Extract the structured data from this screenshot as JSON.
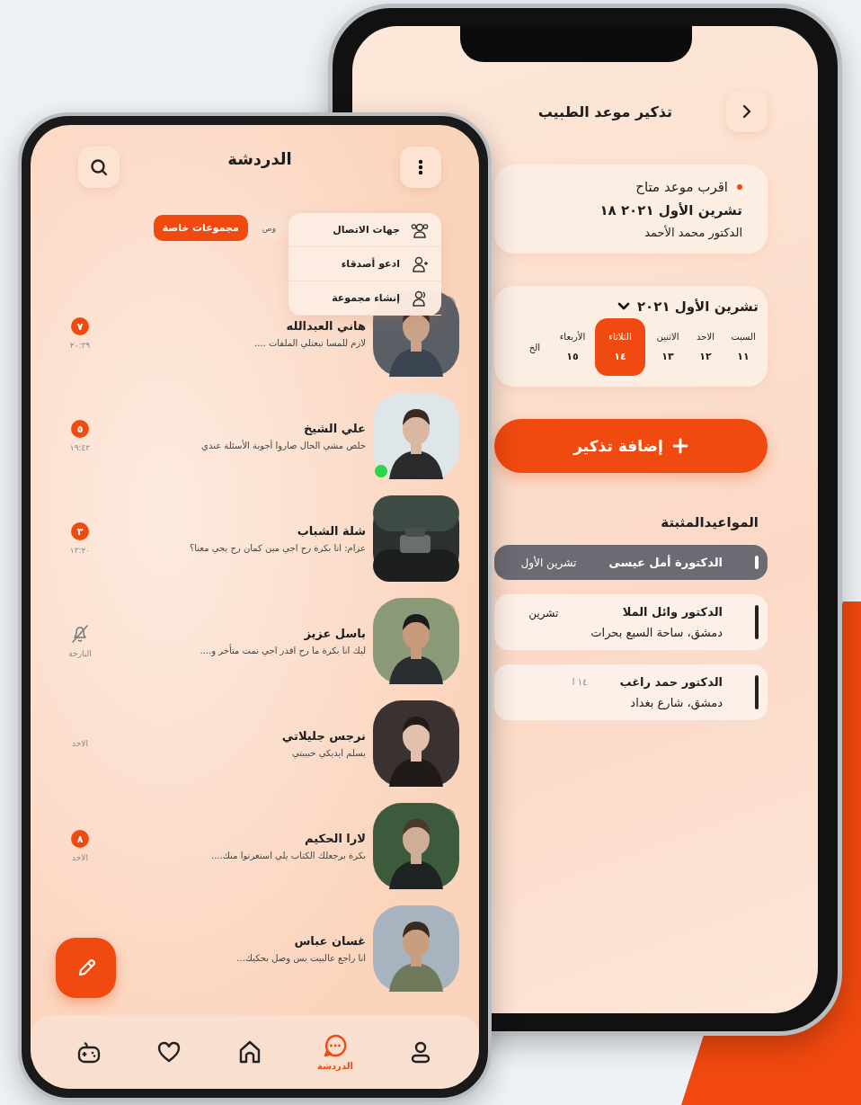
{
  "doctor_app": {
    "title": "تذكير موعد الطبيب",
    "nearest": {
      "label": "اقرب موعد متاح",
      "date": "تشرين الأول ٢٠٢١ ١٨",
      "doctor": "الدكتور محمد الأحمد"
    },
    "calendar": {
      "month": "تشرين الأول ٢٠٢١",
      "days": [
        {
          "name": "السبت",
          "date": "١١",
          "selected": false
        },
        {
          "name": "الاحد",
          "date": "١٢",
          "selected": false
        },
        {
          "name": "الاثنين",
          "date": "١٣",
          "selected": false
        },
        {
          "name": "الثلاثاء",
          "date": "١٤",
          "selected": true
        },
        {
          "name": "الأربعاء",
          "date": "١٥",
          "selected": false
        },
        {
          "name": "الخ",
          "selected": false
        }
      ]
    },
    "add_button": "إضافة تذكير",
    "pinned_title": "المواعيدالمثبتة",
    "pinned": [
      {
        "doctor": "الدكتورة أمل عيسى",
        "date": "تشرين الأول",
        "selected": true
      },
      {
        "doctor": "الدكتور وائل الملا",
        "address": "دمشق، ساحة السبع بحرات",
        "date": "تشرين",
        "selected": false
      },
      {
        "doctor": "الدكتور حمد راغب",
        "address": "دمشق، شارع بغداد",
        "date": "١٤ ا",
        "selected": false
      }
    ]
  },
  "chat_app": {
    "title": "الدردشة",
    "tabs": [
      {
        "label": "وص",
        "selected": false
      },
      {
        "label": "مجموعات خاصة",
        "selected": true
      }
    ],
    "menu": [
      {
        "kind": "contacts",
        "label": "جهات الاتصال"
      },
      {
        "kind": "invite",
        "label": "ادعو أصدقاء"
      },
      {
        "kind": "group",
        "label": "إنشاء مجموعة"
      }
    ],
    "chats": [
      {
        "name": "هاني العبدالله",
        "message": "لازم للمسا تبعتلي الملفات ....",
        "time": "٢٠:٣٩",
        "unread": "٧",
        "muted": false,
        "online": false
      },
      {
        "name": "علي الشيخ",
        "message": "خلص مشي الحال صاروا أجوبة الأسئلة عندي",
        "time": "١٩:٤٣",
        "unread": "٥",
        "muted": false,
        "online": true
      },
      {
        "name": "شلة الشباب",
        "message": "عزام: انا بكرة رح اجي مين كمان رح يجي معنا؟",
        "time": "١٣:٢٠",
        "unread": "٣",
        "muted": false,
        "online": false
      },
      {
        "name": "باسل عزيز",
        "message": "ليك انا بكرة ما رح اقدر اجي نمت متأخر و....",
        "time": "البارحة",
        "muted": true,
        "online": false
      },
      {
        "name": "نرجس جليلاتي",
        "message": "يسلم ايديكي حبيبتي",
        "time": "الاحد",
        "muted": false,
        "online": false
      },
      {
        "name": "لارا الحكيم",
        "message": "بكرة برجعلك الكتاب يلي استعرتوا منك....",
        "time": "الاحد",
        "unread": "٨",
        "muted": false,
        "online": false
      },
      {
        "name": "غسان عباس",
        "message": "انا راجع عالبيت بس وصل بحكيك...",
        "muted": false,
        "online": false
      }
    ],
    "nav": [
      {
        "kind": "profile",
        "selected": false
      },
      {
        "kind": "chat",
        "label": "الدردشة",
        "selected": true
      },
      {
        "kind": "home",
        "selected": false
      },
      {
        "kind": "heart",
        "selected": false
      },
      {
        "kind": "game",
        "selected": false
      }
    ]
  }
}
